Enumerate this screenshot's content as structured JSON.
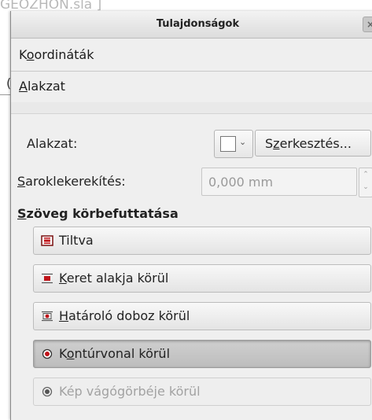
{
  "background": {
    "partial_text": "GEOZHON.sla ]"
  },
  "left_edge": {
    "partial_text": "("
  },
  "dialog": {
    "title": "Tulajdonságok",
    "close_glyph": "×",
    "sections": [
      {
        "label": "Koordináták",
        "mnemonic": "o"
      },
      {
        "label": "Alakzat",
        "mnemonic": "A"
      }
    ],
    "shape": {
      "label": "Alakzat:",
      "dropdown_chevron": "⌄",
      "edit_label": "Szerkesztés..."
    },
    "corner": {
      "label": "Saroklekerekítés:",
      "value": "0,000 mm",
      "arrows": [
        "⌃",
        "⌄"
      ]
    },
    "wrap": {
      "title": "Szöveg körbefuttatása",
      "options": [
        {
          "label": "Tiltva",
          "icon": "wrap-disabled-icon",
          "state": "normal"
        },
        {
          "label": "Keret alakja körül",
          "icon": "wrap-frame-icon",
          "state": "normal"
        },
        {
          "label": "Határoló doboz körül",
          "icon": "wrap-bbox-icon",
          "state": "normal"
        },
        {
          "label": "Kontúrvonal körül",
          "icon": "wrap-contour-icon",
          "state": "active"
        },
        {
          "label": "Kép vágógörbéje körül",
          "icon": "wrap-clip-icon",
          "state": "disabled"
        }
      ]
    }
  },
  "colors": {
    "accent_red": "#c0141a",
    "panel_bg": "#efefef"
  }
}
